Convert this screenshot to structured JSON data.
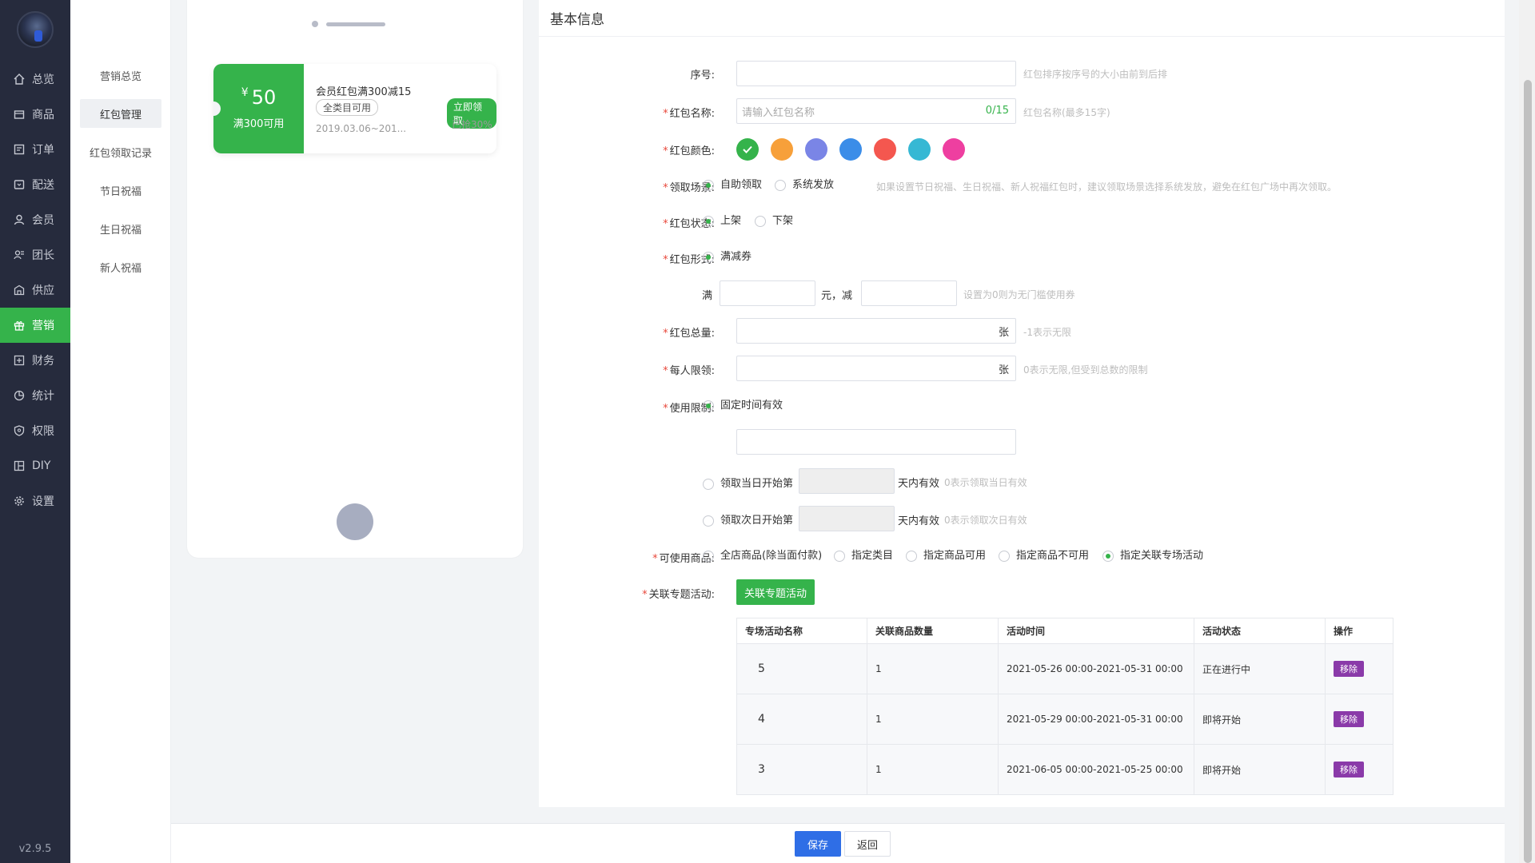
{
  "nav": {
    "items": [
      {
        "label": "总览",
        "icon": "home-icon"
      },
      {
        "label": "商品",
        "icon": "box-icon"
      },
      {
        "label": "订单",
        "icon": "order-icon"
      },
      {
        "label": "配送",
        "icon": "truck-icon"
      },
      {
        "label": "会员",
        "icon": "user-icon"
      },
      {
        "label": "团长",
        "icon": "group-icon"
      },
      {
        "label": "供应",
        "icon": "supply-icon"
      },
      {
        "label": "营销",
        "icon": "gift-icon"
      },
      {
        "label": "财务",
        "icon": "finance-icon"
      },
      {
        "label": "统计",
        "icon": "pie-chart-icon"
      },
      {
        "label": "权限",
        "icon": "shield-icon"
      },
      {
        "label": "DIY",
        "icon": "layout-icon"
      },
      {
        "label": "设置",
        "icon": "gear-icon"
      }
    ],
    "active_index": 7,
    "active_color": "#35b34b",
    "version": "v2.9.5"
  },
  "subnav": {
    "items": [
      "营销总览",
      "红包管理",
      "红包领取记录",
      "节日祝福",
      "生日祝福",
      "新人祝福"
    ],
    "active_index": 1
  },
  "preview": {
    "coupon": {
      "currency": "¥",
      "amount": "50",
      "condition": "满300可用",
      "title": "会员红包满300减15",
      "tag": "全类目可用",
      "date": "2019.03.06~201...",
      "grab_button": "立即领取",
      "grabbed": "已抢30%"
    }
  },
  "form": {
    "section_title": "基本信息",
    "serial": {
      "label": "序号:",
      "value": "",
      "hint": "红包排序按序号的大小由前到后排"
    },
    "name": {
      "label": "红包名称:",
      "placeholder": "请输入红包名称",
      "count": "0/15",
      "hint": "红包名称(最多15字)"
    },
    "color": {
      "label": "红包颜色:",
      "swatches": [
        "#35b34b",
        "#f7a03a",
        "#7a85e6",
        "#3b8de8",
        "#f4574f",
        "#36b8d4",
        "#ee3fa0"
      ],
      "selected_index": 0
    },
    "scene": {
      "label": "领取场景:",
      "options": [
        "自助领取",
        "系统发放"
      ],
      "selected_index": 0,
      "hint": "如果设置节日祝福、生日祝福、新人祝福红包时，建议领取场景选择系统发放，避免在红包广场中再次领取。"
    },
    "status": {
      "label": "红包状态:",
      "options": [
        "上架",
        "下架"
      ],
      "selected_index": 0
    },
    "form_type": {
      "label": "红包形式:",
      "option": "满减券",
      "full_prefix": "满",
      "full_value": "",
      "minus_text": "元，减",
      "minus_value": "",
      "hint": "设置为0则为无门槛使用券"
    },
    "total": {
      "label": "红包总量:",
      "value": "",
      "unit": "张",
      "hint": "-1表示无限"
    },
    "per_limit": {
      "label": "每人限领:",
      "value": "",
      "unit": "张",
      "hint": "0表示无限,但受到总数的限制"
    },
    "usage": {
      "label": "使用限制:",
      "fixed": "固定时间有效",
      "fixed_value": "",
      "same_day": "领取当日开始第",
      "next_day": "领取次日开始第",
      "days_suffix": "天内有效",
      "same_day_hint": "0表示领取当日有效",
      "next_day_hint": "0表示领取次日有效",
      "selected_index": 0
    },
    "goods": {
      "label": "可使用商品:",
      "options": [
        "全店商品(除当面付款)",
        "指定类目",
        "指定商品可用",
        "指定商品不可用",
        "指定关联专场活动"
      ],
      "selected_index": 4
    },
    "related": {
      "label": "关联专题活动:",
      "button": "关联专题活动"
    },
    "table": {
      "headers": [
        "专场活动名称",
        "关联商品数量",
        "活动时间",
        "活动状态",
        "操作"
      ],
      "rows": [
        {
          "name": "5",
          "count": "1",
          "time": "2021-05-26 00:00-2021-05-31 00:00",
          "status": "正在进行中",
          "action": "移除"
        },
        {
          "name": "4",
          "count": "1",
          "time": "2021-05-29 00:00-2021-05-31 00:00",
          "status": "即将开始",
          "action": "移除"
        },
        {
          "name": "3",
          "count": "1",
          "time": "2021-06-05 00:00-2021-05-25 00:00",
          "status": "即将开始",
          "action": "移除"
        }
      ]
    }
  },
  "footer": {
    "save": "保存",
    "back": "返回"
  }
}
